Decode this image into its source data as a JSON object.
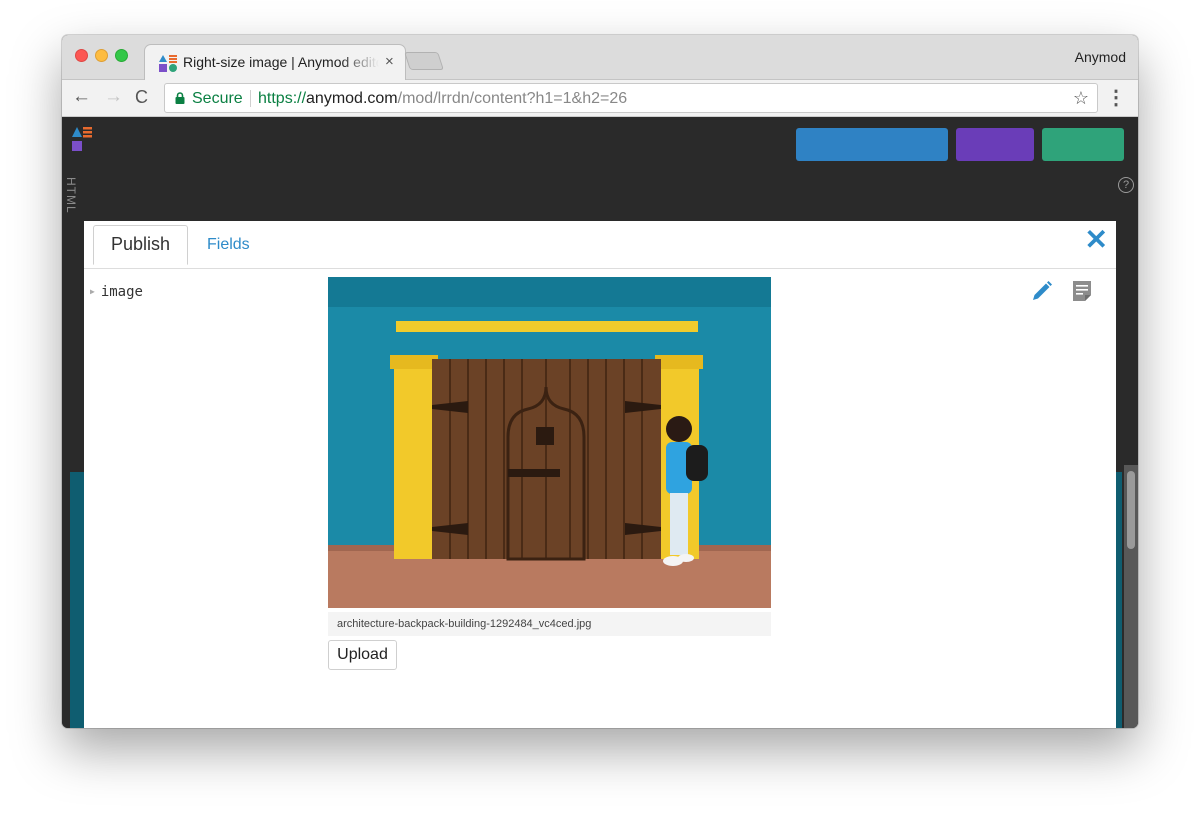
{
  "browser": {
    "tab_title": "Right-size image | Anymod editor",
    "tab_close": "×",
    "profile_name": "Anymod",
    "nav": {
      "back": "←",
      "forward": "→",
      "reload": "C"
    },
    "secure_label": "Secure",
    "url": {
      "scheme": "https://",
      "host": "anymod.com",
      "path": "/mod/lrrdn/content?h1=1&h2=26"
    },
    "star": "☆",
    "menu": "⋮"
  },
  "app": {
    "html_tab": "HTML",
    "help": "?"
  },
  "modal": {
    "tabs": {
      "publish": "Publish",
      "fields": "Fields"
    },
    "close": "✕",
    "tree_item": "image",
    "tree_caret": "▶",
    "filename": "architecture-backpack-building-1292484_vc4ced.jpg",
    "upload_label": "Upload"
  },
  "colors": {
    "accent_blue": "#2e8bc9",
    "secure_green": "#0b8043",
    "app_button_blue": "#2f82c4",
    "app_button_purple": "#6a3db8",
    "app_button_green": "#2fa37a"
  },
  "icons": {
    "edit": "pencil-icon",
    "notes": "notes-icon",
    "close": "close-icon",
    "lock": "lock-icon",
    "star": "star-icon"
  }
}
